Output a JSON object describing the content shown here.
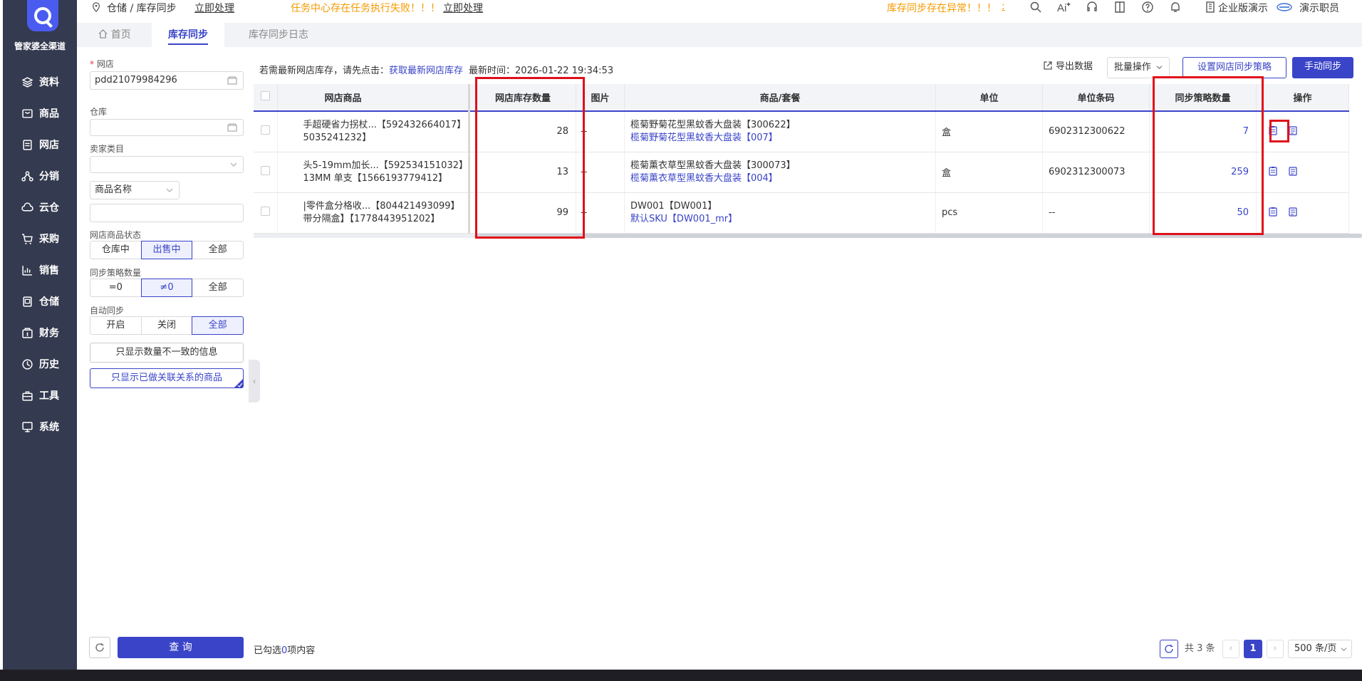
{
  "sidebar": {
    "brand": "管家婆全渠道",
    "items": [
      {
        "label": "资料",
        "icon": "layers-icon"
      },
      {
        "label": "商品",
        "icon": "box-icon"
      },
      {
        "label": "网店",
        "icon": "shop-icon"
      },
      {
        "label": "分销",
        "icon": "network-icon"
      },
      {
        "label": "云仓",
        "icon": "cloud-icon"
      },
      {
        "label": "采购",
        "icon": "cart-icon"
      },
      {
        "label": "销售",
        "icon": "chart-icon"
      },
      {
        "label": "仓储",
        "icon": "warehouse-icon"
      },
      {
        "label": "财务",
        "icon": "finance-icon"
      },
      {
        "label": "历史",
        "icon": "history-icon"
      },
      {
        "label": "工具",
        "icon": "toolbox-icon"
      },
      {
        "label": "系统",
        "icon": "monitor-icon"
      }
    ]
  },
  "topbar": {
    "breadcrumb": "仓储 / 库存同步",
    "action1": "立即处理",
    "task_warning": "任务中心存在任务执行失败！！！",
    "action2": "立即处理",
    "sync_warning": "库存同步存在异常！！！",
    "sync_warning_tail": ":",
    "company": "企业版演示",
    "user": "演示职员"
  },
  "tabs": [
    {
      "label": "首页"
    },
    {
      "label": "库存同步"
    },
    {
      "label": "库存同步日志"
    }
  ],
  "filter": {
    "shop_label": "网店",
    "shop_value": "pdd21079984296",
    "warehouse_label": "仓库",
    "seller_cat_label": "卖家类目",
    "name_select": "商品名称",
    "status_label": "网店商品状态",
    "status_options": [
      "仓库中",
      "出售中",
      "全部"
    ],
    "strategy_label": "同步策略数量",
    "strategy_options": [
      "=0",
      "≠0",
      "全部"
    ],
    "auto_label": "自动同步",
    "auto_options": [
      "开启",
      "关闭",
      "全部"
    ],
    "only_mismatch": "只显示数量不一致的信息",
    "only_linked": "只显示已做关联关系的商品",
    "query_btn": "查 询"
  },
  "toolbar": {
    "info_prefix": "若需最新网店库存，请先点击：",
    "info_link": "获取最新网店库存",
    "info_time": "最新时间：2026-01-22 19:34:53",
    "export": "导出数据",
    "batch": "批量操作",
    "set_strategy": "设置网店同步策略",
    "manual_sync": "手动同步"
  },
  "table": {
    "headers": [
      "网店商品",
      "网店库存数量",
      "图片",
      "商品/套餐",
      "单位",
      "单位条码",
      "同步策略数量",
      "操作"
    ],
    "rows": [
      {
        "shop_line1": "手超硬省力拐杖...【592432664017】",
        "shop_line2": "5035241232】",
        "stock": "28",
        "image": "--",
        "goods_line1": "榄菊野菊花型黑蚊香大盘装【300622】",
        "goods_line2": "榄菊野菊花型黑蚊香大盘装【007】",
        "unit": "盒",
        "barcode": "6902312300622",
        "strategy_qty": "7"
      },
      {
        "shop_line1": "头5-19mm加长...【592534151032】",
        "shop_line2": "13MM 单支【1566193779412】",
        "stock": "13",
        "image": "--",
        "goods_line1": "榄菊薰衣草型黑蚊香大盘装【300073】",
        "goods_line2": "榄菊薰衣草型黑蚊香大盘装【004】",
        "unit": "盒",
        "barcode": "6902312300073",
        "strategy_qty": "259"
      },
      {
        "shop_line1": "|零件盒分格收...【804421493099】",
        "shop_line2": "带分隔盒】【1778443951202】",
        "stock": "99",
        "image": "--",
        "goods_line1": "DW001【DW001】",
        "goods_line2": "默认SKU【DW001_mr】",
        "unit": "pcs",
        "barcode": "--",
        "strategy_qty": "50"
      }
    ]
  },
  "footer": {
    "selected_prefix": "已勾选",
    "selected_count": "0",
    "selected_suffix": "项内容",
    "total": "共 3 条",
    "page": "1",
    "page_size": "500 条/页"
  },
  "colors": {
    "accent": "#3a44c8",
    "nav_bg": "#343a4f",
    "warning": "#f59a00",
    "highlight": "#e0101a"
  }
}
